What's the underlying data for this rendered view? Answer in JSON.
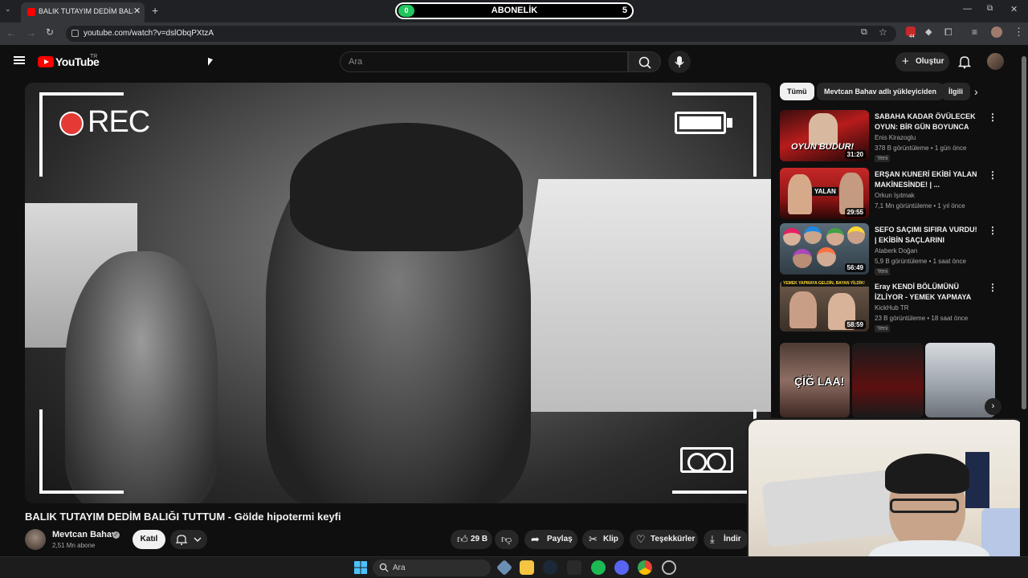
{
  "browser": {
    "tab_title": "BALIK TUTAYIM DEDİM BALIĞI",
    "tab_close": "✕",
    "new_tab": "+",
    "url": "youtube.com/watch?v=dslObqPXtzA",
    "extension_badge": "44"
  },
  "sub_widget": {
    "label": "ABONELİK",
    "count": "5",
    "dot": "0"
  },
  "youtube": {
    "logo_text": "YouTube",
    "region": "TR",
    "search_placeholder": "Ara",
    "create_label": "Oluştur"
  },
  "video": {
    "overlay_rec": "REC",
    "title": "BALIK TUTAYIM DEDİM BALIĞI TUTTUM - Gölde hipotermi keyfi",
    "channel": "Mevtcan Bahav",
    "subscribers": "2,51 Mn abone",
    "join_label": "Katıl",
    "likes": "29 B",
    "share_label": "Paylaş",
    "clip_label": "Klip",
    "thanks_label": "Teşekkürler",
    "download_label": "İndir"
  },
  "sidebar": {
    "chips": [
      "Tümü",
      "Mevtcan Bahav adlı yükleyiciden",
      "İlgili"
    ],
    "items": [
      {
        "title": "SABAHA KADAR ÖVÜLECEK OYUN: BİR GÜN BOYUNCA GO...",
        "channel": "Enis Kirazoglu",
        "meta": "378 B görüntüleme • 1 gün önce",
        "badge": "Yeni",
        "duration": "31:20",
        "thumb_caption": "OYUN BUDUR!"
      },
      {
        "title": "ERŞAN KUNERİ EKİBİ YALAN MAKİNESİNDE! | ...",
        "channel": "Orkun Işıtmak",
        "meta": "7,1 Mn görüntüleme • 1 yıl önce",
        "badge": "",
        "duration": "29:55",
        "thumb_caption": "YALAN"
      },
      {
        "title": "SEFO SAÇIMI SIFIRA VURDU! | EKİBİN SAÇLARINI RENGARE...",
        "channel": "Ataberk Doğan",
        "meta": "5,9 B görüntüleme • 1 saat önce",
        "badge": "Yeni",
        "duration": "56:49",
        "thumb_caption": ""
      },
      {
        "title": "Eray KENDİ BÖLÜMÜNÜ İZLİYOR - YEMEK YAPMAYA ...",
        "channel": "KickHub TR",
        "meta": "23 B görüntüleme • 18 saat önce",
        "badge": "Yeni",
        "duration": "58:59",
        "thumb_caption": "YEMEK YAPMAYA GELDİN, BAYAN YİLDİK!"
      }
    ],
    "shorts_caption": "ÇİĞ LAA!"
  },
  "taskbar": {
    "search_placeholder": "Ara"
  }
}
